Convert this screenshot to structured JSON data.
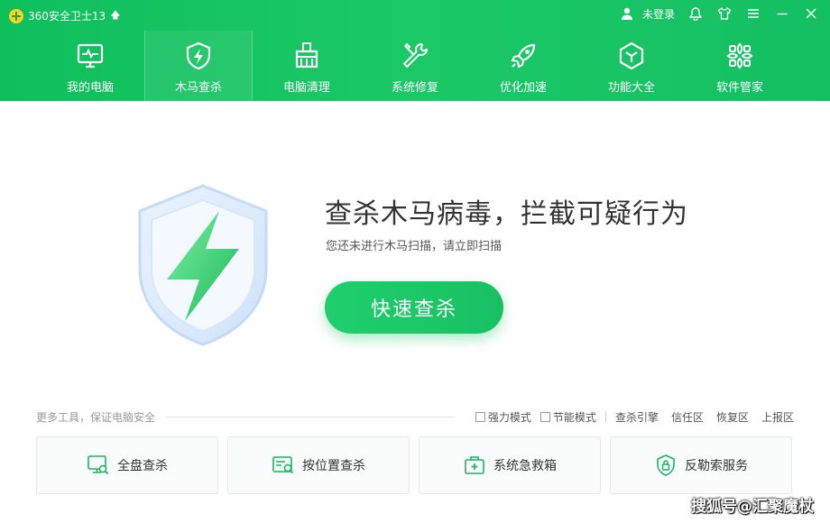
{
  "app": {
    "title": "360安全卫士13",
    "update_arrow": "🡅"
  },
  "user": {
    "status": "未登录"
  },
  "nav": [
    {
      "label": "我的电脑",
      "icon": "monitor-icon"
    },
    {
      "label": "木马查杀",
      "icon": "shield-bolt-icon",
      "active": true
    },
    {
      "label": "电脑清理",
      "icon": "broom-icon"
    },
    {
      "label": "系统修复",
      "icon": "wrench-icon"
    },
    {
      "label": "优化加速",
      "icon": "rocket-icon"
    },
    {
      "label": "功能大全",
      "icon": "hexagon-icon"
    },
    {
      "label": "软件管家",
      "icon": "apps-icon"
    }
  ],
  "main": {
    "headline": "查杀木马病毒，拦截可疑行为",
    "subline": "您还未进行木马扫描，请立即扫描",
    "scan_button": "快速查杀"
  },
  "tools": {
    "title": "更多工具，保证电脑安全",
    "options": [
      {
        "label": "强力模式",
        "checked": false
      },
      {
        "label": "节能模式",
        "checked": false
      }
    ],
    "links": [
      "查杀引擎",
      "信任区",
      "恢复区",
      "上报区"
    ],
    "cards": [
      {
        "label": "全盘查杀",
        "icon": "monitor-search-icon"
      },
      {
        "label": "按位置查杀",
        "icon": "folder-search-icon"
      },
      {
        "label": "系统急救箱",
        "icon": "first-aid-icon"
      },
      {
        "label": "反勒索服务",
        "icon": "shield-lock-icon"
      }
    ]
  },
  "watermark": "搜狐号@汇聚魔杖",
  "colors": {
    "brand_green": "#1bc866",
    "button_green": "#1fcf6d",
    "accent_icon": "#18b862"
  }
}
